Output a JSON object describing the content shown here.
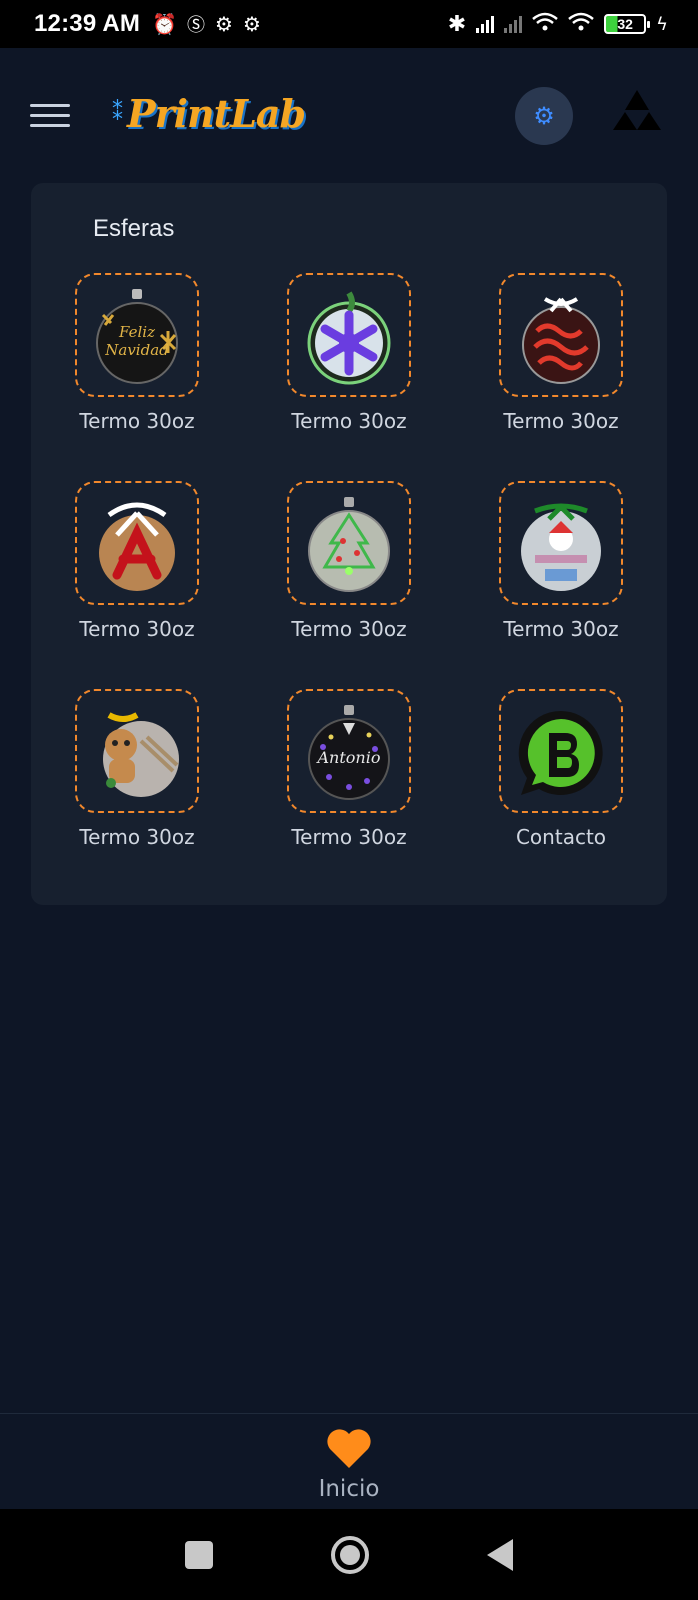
{
  "status_bar": {
    "time": "12:39 AM",
    "battery": "32",
    "icons": [
      "alarm-icon",
      "sim-icon",
      "settings-icon",
      "settings-icon",
      "bluetooth-icon",
      "signal-icon",
      "signal-off-icon",
      "wifi-call-icon",
      "wifi-icon",
      "battery-icon",
      "charging-icon"
    ]
  },
  "header": {
    "logo_text": "PrintLab",
    "accent_color": "#f5a623",
    "theme_toggle_icon": "gear-icon"
  },
  "section": {
    "title": "Esferas",
    "items": [
      {
        "label": "Termo 30oz",
        "image": "ornament-feliz-navidad"
      },
      {
        "label": "Termo 30oz",
        "image": "ornament-snowflake-purple"
      },
      {
        "label": "Termo 30oz",
        "image": "ornament-red-glitter"
      },
      {
        "label": "Termo 30oz",
        "image": "ornament-letter-a"
      },
      {
        "label": "Termo 30oz",
        "image": "ornament-tree"
      },
      {
        "label": "Termo 30oz",
        "image": "ornament-snowman"
      },
      {
        "label": "Termo 30oz",
        "image": "ornament-gingerbread"
      },
      {
        "label": "Termo 30oz",
        "image": "ornament-antonio"
      },
      {
        "label": "Contacto",
        "image": "whatsapp-business-icon"
      }
    ],
    "image_texts": {
      "feliz": "Feliz",
      "navidad": "Navidad",
      "antonio": "Antonio"
    }
  },
  "bottom_nav": {
    "label": "Inicio",
    "icon": "heart-icon",
    "icon_color": "#ff8c1a"
  },
  "colors": {
    "background": "#0e1626",
    "card": "#17202f",
    "dashed_border": "#f2882c"
  }
}
